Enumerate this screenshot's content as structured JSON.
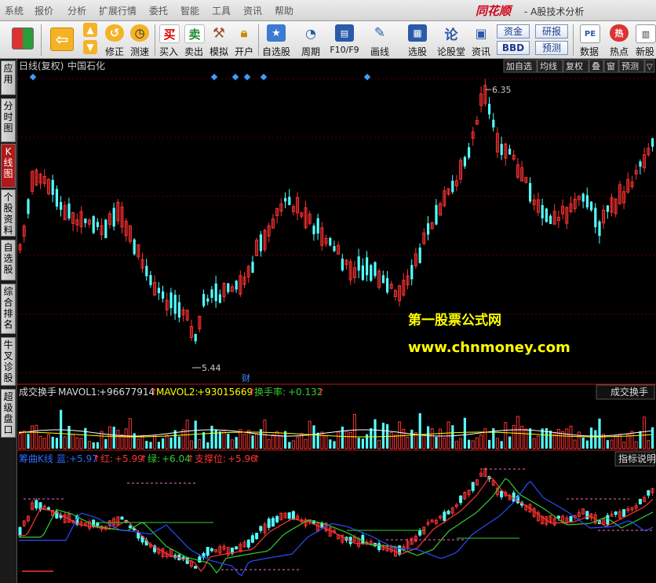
{
  "menu": [
    "系统",
    "报价",
    "分析",
    "扩展行情",
    "委托",
    "智能",
    "工具",
    "资讯",
    "帮助"
  ],
  "brand": "同花顺",
  "app_title": "- A股技术分析",
  "toolbar": {
    "fix": "修正",
    "speed": "测速",
    "buy": "买入",
    "sell": "卖出",
    "sim": "模拟",
    "open": "开户",
    "watchlist": "自选股",
    "period": "周期",
    "f10": "F10/F9",
    "draw": "画线",
    "pick": "选股",
    "forum": "论股堂",
    "info": "资讯",
    "funds": "资金",
    "research": "研报",
    "bbd": "BBD",
    "forecast": "预测",
    "data": "数据",
    "hot": "热点",
    "newstock": "新股",
    "buy_glyph": "买",
    "sell_glyph": "卖",
    "forum_glyph": "论",
    "data_glyph": "PE",
    "hot_glyph": "热"
  },
  "sidebar": [
    "应用",
    "分时图",
    "K线图",
    "个股资料",
    "自选股",
    "综合排名",
    "牛叉诊股",
    "超级盘口"
  ],
  "colors": {
    "up": "#ff3232",
    "down": "#54ffff",
    "bg": "#000000",
    "accent": "#b21818"
  },
  "kline_header": {
    "title": "日线(复权)",
    "stock": "中国石化"
  },
  "kline_tabs": [
    "加自选",
    "均线",
    "复权",
    "叠",
    "窗",
    "预测"
  ],
  "price_high": "6.35",
  "price_low": "5.44",
  "cai_marker": "财",
  "watermark": {
    "title": "第一股票公式网",
    "url": "www.chnmoney.com"
  },
  "volume_header": {
    "name": "成交换手",
    "mavol1_label": "MAVOL1:",
    "mavol1": "+96677914",
    "mavol1_arrow": "↑",
    "mavol2_label": "MAVOL2:",
    "mavol2": "+93015669",
    "mavol2_arrow": "↑",
    "turnover_label": "换手率:",
    "turnover": "+0.132",
    "turnover_arrow": "↑",
    "button": "成交换手"
  },
  "indicator_header": {
    "name": "筹曲K线",
    "blue_label": "蓝:",
    "blue": "+5.97",
    "blue_arrow": "↑",
    "red_label": "红:",
    "red": "+5.99",
    "red_arrow": "↑",
    "green_label": "绿:",
    "green": "+6.04",
    "green_arrow": "↑",
    "support_label": "支撑位:",
    "support": "+5.96",
    "support_arrow": "↑",
    "button": "指标说明"
  }
}
